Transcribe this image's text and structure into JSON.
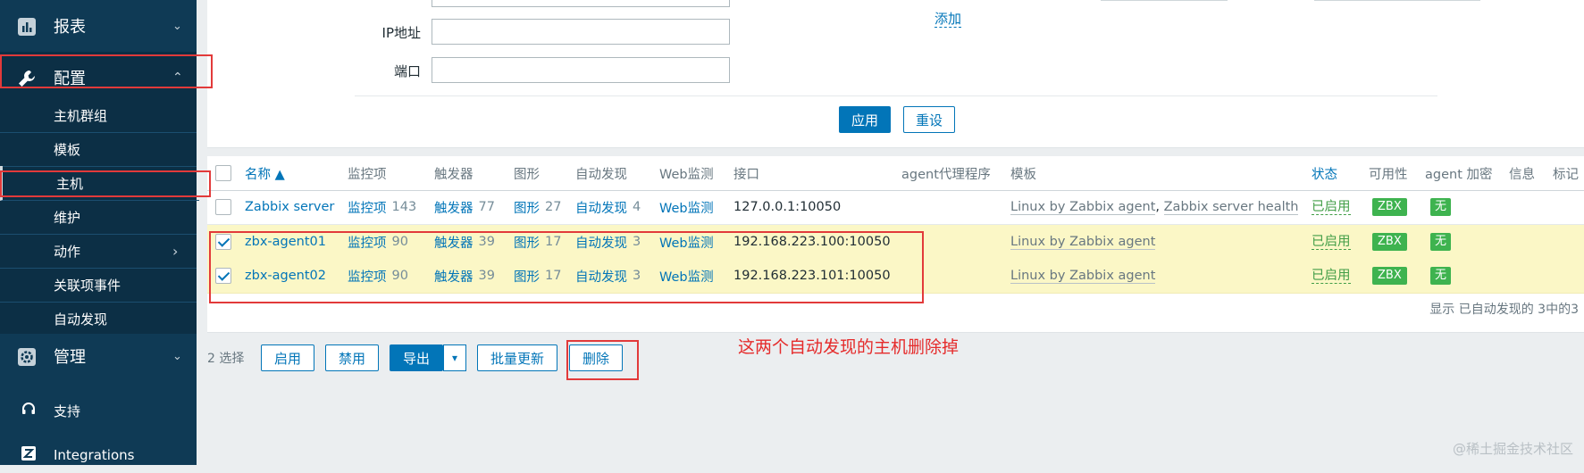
{
  "sidebar": {
    "reports": "报表",
    "config": "配置",
    "config_items": [
      "主机群组",
      "模板",
      "主机",
      "维护",
      "动作",
      "关联项事件",
      "自动发现"
    ],
    "admin": "管理",
    "support": "支持",
    "integrations": "Integrations"
  },
  "filter": {
    "ip_label": "IP地址",
    "port_label": "端口",
    "add_link": "添加",
    "apply": "应用",
    "reset": "重设"
  },
  "table": {
    "headers": {
      "name": "名称 ▲",
      "items": "监控项",
      "triggers": "触发器",
      "graphs": "图形",
      "discovery": "自动发现",
      "web": "Web监测",
      "interface": "接口",
      "proxy": "agent代理程序",
      "templates": "模板",
      "status": "状态",
      "availability": "可用性",
      "encryption": "agent 加密",
      "info": "信息",
      "tags": "标记"
    },
    "rows": [
      {
        "checked": false,
        "name": "Zabbix server",
        "items_label": "监控项",
        "items_count": "143",
        "triggers_label": "触发器",
        "triggers_count": "77",
        "graphs_label": "图形",
        "graphs_count": "27",
        "discovery_label": "自动发现",
        "discovery_count": "4",
        "web": "Web监测",
        "interface": "127.0.0.1:10050",
        "template1": "Linux by Zabbix agent",
        "template_sep": ",",
        "template2": "Zabbix server health",
        "status": "已启用",
        "availability": "ZBX",
        "encryption": "无"
      },
      {
        "checked": true,
        "name": "zbx-agent01",
        "items_label": "监控项",
        "items_count": "90",
        "triggers_label": "触发器",
        "triggers_count": "39",
        "graphs_label": "图形",
        "graphs_count": "17",
        "discovery_label": "自动发现",
        "discovery_count": "3",
        "web": "Web监测",
        "interface": "192.168.223.100:10050",
        "template1": "Linux by Zabbix agent",
        "status": "已启用",
        "availability": "ZBX",
        "encryption": "无"
      },
      {
        "checked": true,
        "name": "zbx-agent02",
        "items_label": "监控项",
        "items_count": "90",
        "triggers_label": "触发器",
        "triggers_count": "39",
        "graphs_label": "图形",
        "graphs_count": "17",
        "discovery_label": "自动发现",
        "discovery_count": "3",
        "web": "Web监测",
        "interface": "192.168.223.101:10050",
        "template1": "Linux by Zabbix agent",
        "status": "已启用",
        "availability": "ZBX",
        "encryption": "无"
      }
    ],
    "footer": "显示 已自动发现的 3中的3"
  },
  "actions": {
    "selected": "2 选择",
    "enable": "启用",
    "disable": "禁用",
    "export": "导出",
    "mass_update": "批量更新",
    "delete": "删除"
  },
  "annotation": "这两个自动发现的主机删除掉",
  "watermark": "@稀土掘金技术社区",
  "colors": {
    "sidebar": "#0f3a55",
    "accent": "#0275b8",
    "enabled": "#429e47",
    "badge": "#3eb34f",
    "selected_row": "#fbf7c6",
    "annotation": "#e23a3a"
  }
}
